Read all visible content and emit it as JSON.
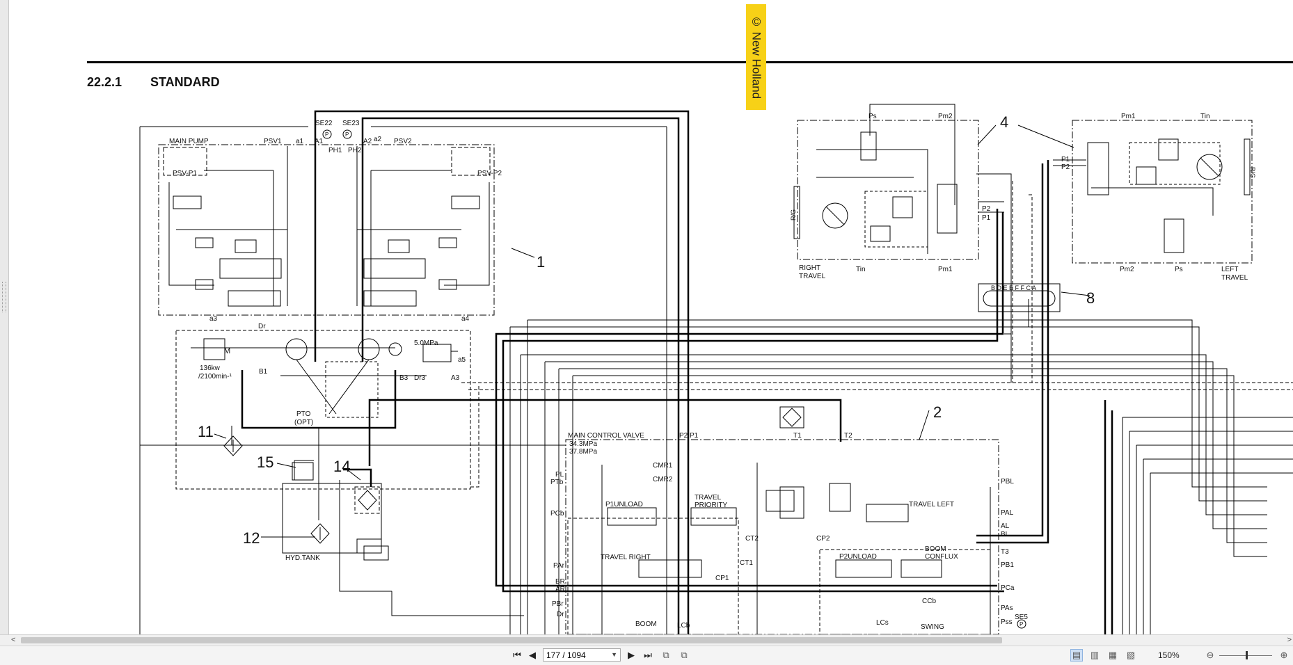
{
  "watermark": "© New Holland",
  "section": {
    "number": "22.2.1",
    "title": "STANDARD"
  },
  "schematic": {
    "callouts": {
      "c1": "1",
      "c2": "2",
      "c4": "4",
      "c8": "8",
      "c11": "11",
      "c12": "12",
      "c14": "14",
      "c15": "15"
    },
    "pump": {
      "main_pump": "MAIN PUMP",
      "psv1": "PSV1",
      "psv2": "PSV2",
      "psv_p1": "PSV-P1",
      "psv_p2": "PSV-P2",
      "a1": "a1",
      "a2": "a2",
      "a3": "a3",
      "a4": "a4",
      "a5": "a5",
      "se22": "SE22",
      "se23": "SE23",
      "ph1": "PH1",
      "ph2": "PH2",
      "A1": "A1",
      "A2": "A2",
      "dr": "Dr",
      "b1": "B1",
      "b3": "B3",
      "dr3": "Dr3",
      "A3": "A3",
      "mpa": "5.0MPa",
      "motor": "M",
      "kw": "136kw",
      "rpm": "/2100min-¹",
      "pto": "PTO",
      "opt": "(OPT)",
      "tank": "HYD.TANK",
      "p": "P"
    },
    "travel": {
      "ps": "Ps",
      "pm2": "Pm2",
      "pm1": "Pm1",
      "tin": "Tin",
      "p1": "P1",
      "p2": "P2",
      "rg": "R/G",
      "right_travel_1": "RIGHT",
      "right_travel_2": "TRAVEL",
      "left_travel_1": "LEFT",
      "left_travel_2": "TRAVEL",
      "swivel_ports": "B D E E F F C A"
    },
    "mcv": {
      "title": "MAIN CONTROL VALVE",
      "p2p1": "P2 P1",
      "mpa1": "34.3MPa",
      "mpa2": "37.8MPa",
      "t1": "T1",
      "t2": "T2",
      "cmr1": "CMR1",
      "cmr2": "CMR2",
      "pl": "PL",
      "ptb": "PTb",
      "pcb": "PCb",
      "p1unload": "P1UNLOAD",
      "travel_priority_1": "TRAVEL",
      "travel_priority_2": "PRIORITY",
      "travel_left": "TRAVEL LEFT",
      "pbl": "PBL",
      "pal": "PAL",
      "al": "AL",
      "bl": "BL",
      "ct2": "CT2",
      "cp2": "CP2",
      "t3": "T3",
      "pb1": "PB1",
      "par": "PAr",
      "travel_right": "TRAVEL RIGHT",
      "ct1": "CT1",
      "br": "BR",
      "ar": "AR",
      "cp1": "CP1",
      "pbr": "PBr",
      "dr": "Dr",
      "p2unload": "P2UNLOAD",
      "boom_conflux_1": "BOOM",
      "boom_conflux_2": "CONFLUX",
      "ccb": "CCb",
      "pca": "PCa",
      "pas": "PAs",
      "pss": "Pss",
      "se5": "SE5",
      "boom": "BOOM",
      "lcb": "LCb",
      "lcs": "LCs",
      "swing": "SWING"
    }
  },
  "viewer": {
    "page_value": "177 / 1094",
    "zoom_value": "150%",
    "icons": [
      "first-page-icon",
      "prev-page-icon",
      "next-page-icon",
      "last-page-icon"
    ]
  }
}
